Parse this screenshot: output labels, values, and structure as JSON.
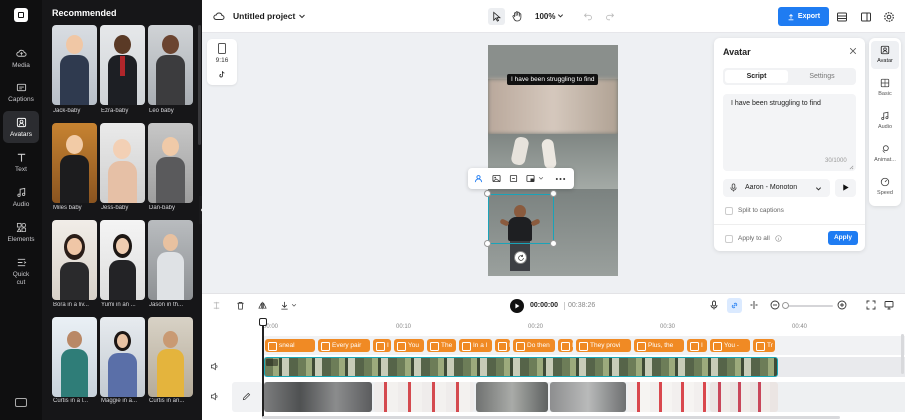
{
  "rail": {
    "items": [
      {
        "label": "Media",
        "icon": "cloud-upload-icon"
      },
      {
        "label": "Captions",
        "icon": "captions-icon"
      },
      {
        "label": "Avatars",
        "icon": "avatar-icon"
      },
      {
        "label": "Text",
        "icon": "text-icon"
      },
      {
        "label": "Audio",
        "icon": "music-note-icon"
      },
      {
        "label": "Elements",
        "icon": "elements-icon"
      },
      {
        "label": "Quick cut",
        "icon": "quick-cut-icon"
      }
    ],
    "active": "Avatars"
  },
  "panel": {
    "title": "Recommended",
    "avatars": [
      {
        "name": "Jack-baby"
      },
      {
        "name": "Ezra-baby"
      },
      {
        "name": "Leo baby"
      },
      {
        "name": "Miles baby"
      },
      {
        "name": "Jess-baby"
      },
      {
        "name": "Dan-baby"
      },
      {
        "name": "Bora in a liv..."
      },
      {
        "name": "Yumi in an ..."
      },
      {
        "name": "Jason in th..."
      },
      {
        "name": "Curtis in a l..."
      },
      {
        "name": "Maggie in a..."
      },
      {
        "name": "Curtis in an..."
      }
    ]
  },
  "topbar": {
    "project_title": "Untitled project",
    "zoom": "100%",
    "export_label": "Export"
  },
  "canvas": {
    "ratio_label": "9:16",
    "caption_text": "I have been struggling to find"
  },
  "avatar_panel": {
    "title": "Avatar",
    "tabs": [
      "Script",
      "Settings"
    ],
    "active_tab": "Script",
    "script_text": "I have been struggling to find",
    "char_count": "30/1000",
    "voice": "Aaron - Monoton",
    "split_label": "Split to captions",
    "apply_all_label": "Apply to all",
    "apply_label": "Apply"
  },
  "right_tools": [
    {
      "label": "Avatar",
      "icon": "avatar-icon"
    },
    {
      "label": "Basic",
      "icon": "basic-icon"
    },
    {
      "label": "Audio",
      "icon": "music-note-icon"
    },
    {
      "label": "Animat...",
      "icon": "animation-icon"
    },
    {
      "label": "Speed",
      "icon": "speed-icon"
    }
  ],
  "timeline": {
    "current_time": "00:00:00",
    "total_time": "00:38:26",
    "ruler": [
      "00:00",
      "00:10",
      "00:20",
      "00:30",
      "00:40"
    ],
    "captions": [
      "sneal",
      "Every pair",
      "I",
      "You",
      "The",
      "In a l",
      "I",
      "Do then",
      "I",
      "They provi",
      "Plus, the",
      "I",
      "You -",
      "Tr"
    ]
  },
  "colors": {
    "accent": "#1f7cf2",
    "caption_chip": "#f08a24",
    "panel_bg": "#161618",
    "rail_bg": "#0f0f10"
  }
}
